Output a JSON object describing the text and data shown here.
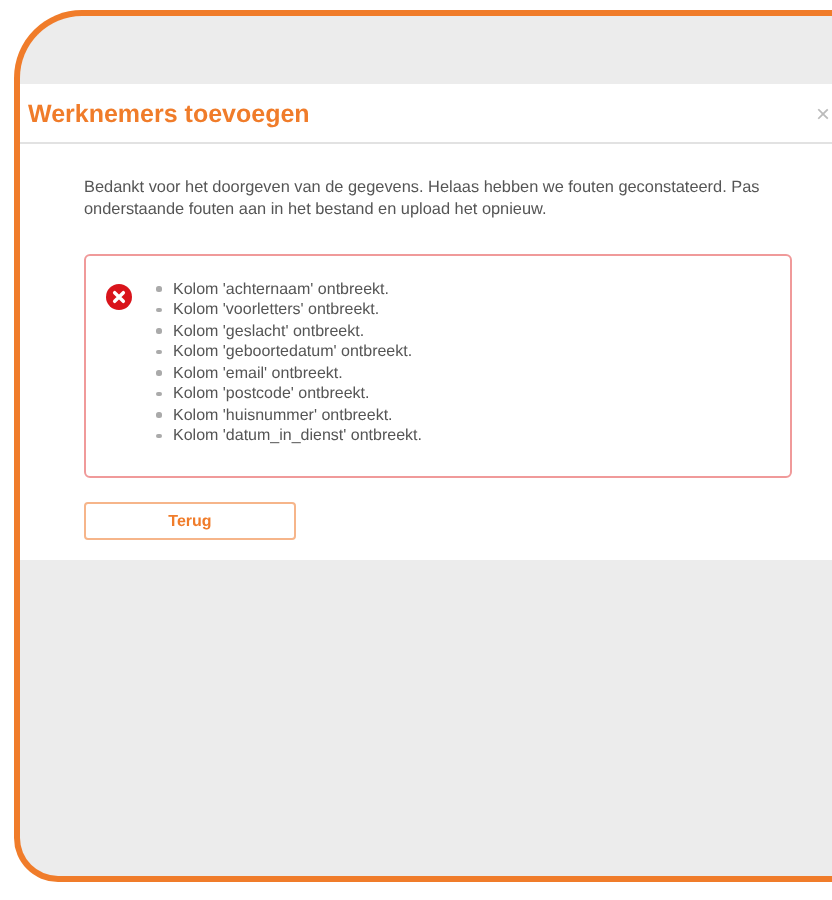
{
  "dialog": {
    "title": "Werknemers toevoegen",
    "close": "×",
    "message": "Bedankt voor het doorgeven van de gegevens. Helaas hebben we fouten geconstateerd. Pas onderstaande fouten aan in het bestand en upload het opnieuw.",
    "errors": [
      "Kolom 'achternaam' ontbreekt.",
      "Kolom 'voorletters' ontbreekt.",
      "Kolom 'geslacht' ontbreekt.",
      "Kolom 'geboortedatum' ontbreekt.",
      "Kolom 'email' ontbreekt.",
      "Kolom 'postcode' ontbreekt.",
      "Kolom 'huisnummer' ontbreekt.",
      "Kolom 'datum_in_dienst' ontbreekt."
    ],
    "button": "Terug"
  }
}
